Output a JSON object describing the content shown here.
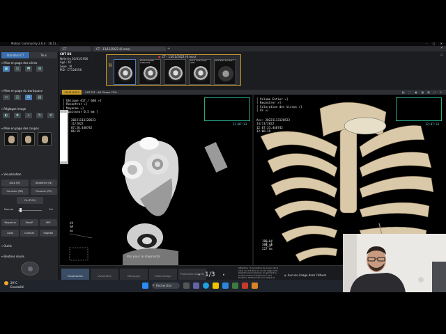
{
  "window": {
    "title": "Mohan Community 2.6.4 · 18.11...",
    "controls": "–  ▢  ✕"
  },
  "tabs": [
    {
      "label": "CT"
    },
    {
      "label": "CT · 13/11/2022 (6 mos)"
    }
  ],
  "left_panel": {
    "mode_tabs": [
      "Standard CT",
      "Tous"
    ],
    "sections": [
      {
        "label": "Mise en page des séries"
      },
      {
        "label": "Mise en page du workspace"
      },
      {
        "label": "Réglages image"
      },
      {
        "label": "Mise en page des coupes"
      },
      {
        "label": "Visualisation"
      },
      {
        "label": "Outils"
      },
      {
        "label": "Boutons souris"
      }
    ],
    "vis_buttons": [
      "Auto (M)",
      "Abdomen (N)",
      "Cerveau (PB)",
      "Poumon (PS)"
    ],
    "os_button": "Os (PUO)",
    "slider_labels": [
      "Normal",
      "Oui"
    ],
    "render_buttons": [
      "Moyenne",
      "MaxIP",
      "MIP",
      "Axial",
      "Coronal",
      "Sagittal"
    ]
  },
  "study": {
    "name": "CHT D3",
    "lines": [
      "Né(e) le 01/01/1956",
      "Age : 67",
      "Sexe : M",
      "PID : CT124556"
    ],
    "series_header": "CT · 13/11/2022 (6 mos)",
    "series": [
      {
        "title": "",
        "selected": true
      },
      {
        "title": "MULTI PHASES 1/99/2379",
        "selected": false
      },
      {
        "title": "",
        "selected": false
      },
      {
        "title": "Série Smart Prep 4/38",
        "selected": false
      },
      {
        "title": "Résultats Flat 6/13",
        "selected": false
      }
    ]
  },
  "viewer": {
    "date": "13/11/2022",
    "phase": "CHT D3 · #2 Phase 75%",
    "tools": "◧ ⬚ ▣ ◨ ⬒ ⤢ ✕"
  },
  "left_view": {
    "overlay": "[ Oblique 417 / 660 »]\n[ Recentrer »]\n[ Moyenne »]\n[ Épaisseur 0,5 mm ]",
    "meta": "20221113120523\n11/2022\n07:26.440742\n06:19",
    "timer": "12:07:33",
    "bottom": "kV\nmA\nms",
    "diag": "Pas pour le diagnostic"
  },
  "right_view": {
    "overlay": "[ Volume Entier »]\n[ Recentrer »]\n[ Coloration des tissus »]\n[ Os »]",
    "meta": "Acc: 20221113120523\n13/11/2022\n12:07:33.440742\n12:06:19",
    "timer": "12:07:33",
    "bottom": "100 kV\n300 mA\n227 ms"
  },
  "bottom_bar": {
    "buttons": [
      "Visualisation",
      "Volumétrie",
      "Marquage",
      "Reformatage",
      "Protocoles Avancés"
    ],
    "pager": "1/3",
    "message": "Attention ! L'ouverture de coupe de la série ne doit être en mode diagnostic. Sélectionnez l'examen en gardant le bouton enfoncé (Ctrl/ouvrir vers fenêtre). Utilisez Ctrl pour déplacer",
    "chip": "Aucune image dans l'album"
  },
  "taskbar": {
    "temp": "20°C",
    "weather": "Ensoleillé",
    "search": "Rechercher",
    "app_colors": [
      "#ffffff",
      "#0078d4",
      "#2b88d8",
      "#f0c400",
      "#1fa0e0",
      "#3d7b3e",
      "#c7392b",
      "#d7832a",
      "#ffffff"
    ]
  },
  "colors": {
    "accent_gold": "#c79b2c",
    "selection_blue": "#4e7bb8",
    "inset_teal": "#2aa88a"
  }
}
